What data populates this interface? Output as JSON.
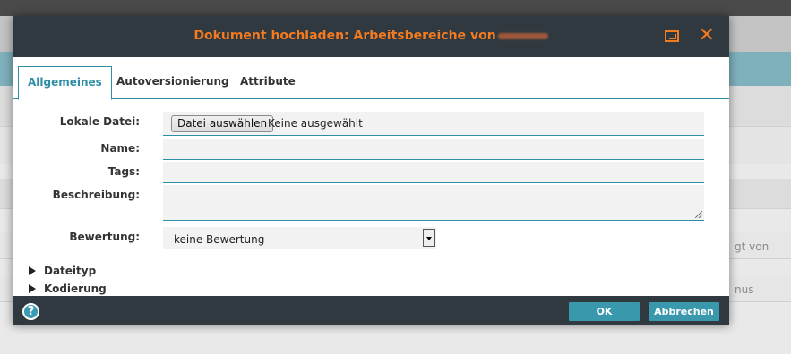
{
  "background": {
    "side_texts": [
      "gt von",
      "nus"
    ]
  },
  "dialog": {
    "title": "Dokument hochladen: Arbeitsbereiche von",
    "icons": {
      "maximize": "maximize-icon",
      "close": "close-icon",
      "help": "help-icon"
    },
    "close_glyph": "✕",
    "help_glyph": "?",
    "tabs": [
      {
        "label": "Allgemeines",
        "active": true
      },
      {
        "label": "Autoversionierung",
        "active": false
      },
      {
        "label": "Attribute",
        "active": false
      }
    ],
    "form": {
      "local_file_label": "Lokale Datei:",
      "file_button_label": "Datei auswählen",
      "file_status": "Keine ausgewählt",
      "name_label": "Name:",
      "name_value": "",
      "tags_label": "Tags:",
      "tags_value": "",
      "description_label": "Beschreibung:",
      "description_value": "",
      "rating_label": "Bewertung:",
      "rating_value": "keine Bewertung"
    },
    "sections": [
      "Dateityp",
      "Kodierung"
    ],
    "footer": {
      "ok_label": "OK",
      "cancel_label": "Abbrechen"
    },
    "colors": {
      "accent": "#f47b20",
      "teal": "#2e8ea6",
      "dark": "#2f393f"
    }
  }
}
